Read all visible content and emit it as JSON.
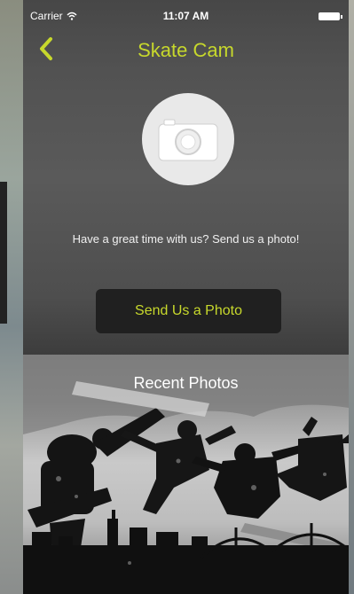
{
  "status_bar": {
    "carrier": "Carrier",
    "time": "11:07 AM"
  },
  "nav": {
    "title": "Skate Cam"
  },
  "main": {
    "prompt": "Have a great time with us? Send us a photo!",
    "send_button_label": "Send Us a Photo"
  },
  "photos": {
    "title": "Recent Photos"
  },
  "colors": {
    "accent": "#c7d82c",
    "button_bg": "#202020",
    "circle": "#e9e9e9"
  },
  "icons": {
    "back": "chevron-left-icon",
    "camera": "camera-icon",
    "wifi": "wifi-icon",
    "battery": "battery-icon"
  }
}
